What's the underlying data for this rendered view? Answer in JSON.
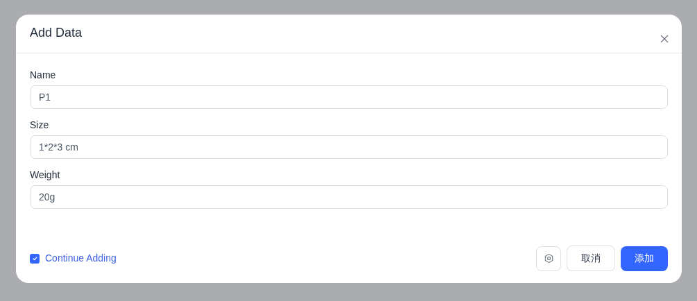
{
  "dialog": {
    "title": "Add Data",
    "fields": [
      {
        "label": "Name",
        "value": "P1"
      },
      {
        "label": "Size",
        "value": "1*2*3 cm"
      },
      {
        "label": "Weight",
        "value": "20g"
      }
    ],
    "continue_adding": {
      "label": "Continue Adding",
      "checked": true
    },
    "buttons": {
      "cancel": "取消",
      "submit": "添加"
    }
  }
}
